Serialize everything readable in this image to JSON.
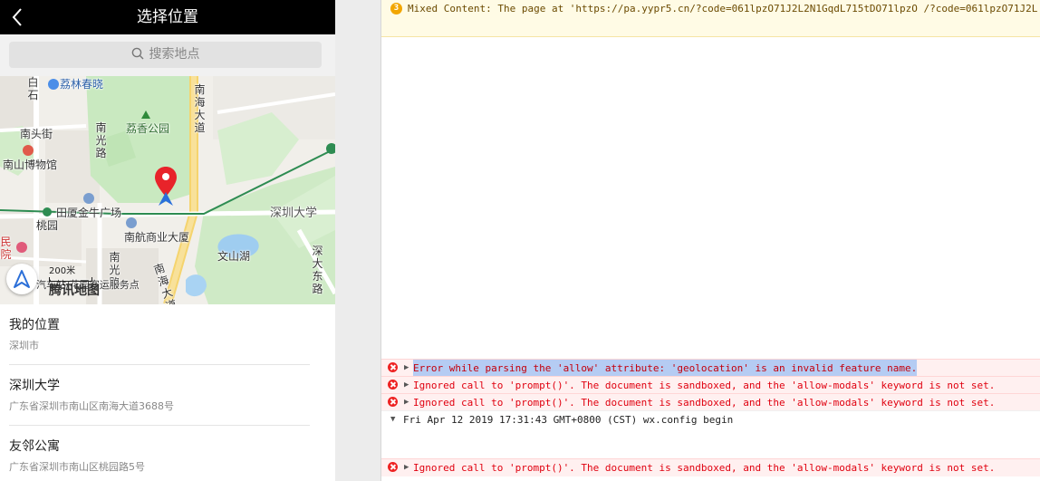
{
  "nav": {
    "title": "选择位置"
  },
  "search": {
    "placeholder": "搜索地点"
  },
  "map": {
    "labels": {
      "litchi_spring": "荔林春晓",
      "litchi_park": "荔香公园",
      "nanhai_road_top": "南海大道",
      "nanguang_road": "南光路",
      "nantou_street": "南头街",
      "nanshan_museum": "南山博物馆",
      "taoyuan": "桃园",
      "tianxia_plaza": "田厦金牛广场",
      "nanhang_building": "南航商业大厦",
      "shenzhen_univ": "深圳大学",
      "wenshan_lake": "文山湖",
      "shenda_east": "深大东路",
      "nanguang_road2": "南光路",
      "nanhai_road_bottom": "南海大道",
      "min_yuan": "民院",
      "baishi": "白石",
      "bottom_road": "汽车站/花园客运服务点"
    },
    "scale": "200米",
    "brand": "腾讯地图"
  },
  "places": [
    {
      "name": "我的位置",
      "address": "深圳市"
    },
    {
      "name": "深圳大学",
      "address": "广东省深圳市南山区南海大道3688号"
    },
    {
      "name": "友邻公寓",
      "address": "广东省深圳市南山区桃园路5号"
    }
  ],
  "console": {
    "warning_count": "3",
    "warning_text": "Mixed Content: The page at 'https://pa.yypr5.cn/?code=061lpzO71J2L2N1GqdL715tDO71lpzO /?code=061lpzO71J2L",
    "messages": [
      {
        "type": "error",
        "text": "Error while parsing the 'allow' attribute: 'geolocation' is an invalid feature name."
      },
      {
        "type": "error",
        "text": "Ignored call to 'prompt()'. The document is sandboxed, and the 'allow-modals' keyword is not set."
      },
      {
        "type": "error",
        "text": "Ignored call to 'prompt()'. The document is sandboxed, and the 'allow-modals' keyword is not set."
      },
      {
        "type": "log",
        "text": "Fri Apr 12 2019 17:31:43 GMT+0800 (CST) wx.config begin"
      },
      {
        "type": "error",
        "text": "Ignored call to 'prompt()'. The document is sandboxed, and the 'allow-modals' keyword is not set."
      }
    ]
  },
  "colors": {
    "nav_bg": "#000000",
    "error_text": "#e0000f",
    "error_bg": "#fff0f0",
    "warning_badge": "#f2a600",
    "pin": "#e8232a"
  }
}
